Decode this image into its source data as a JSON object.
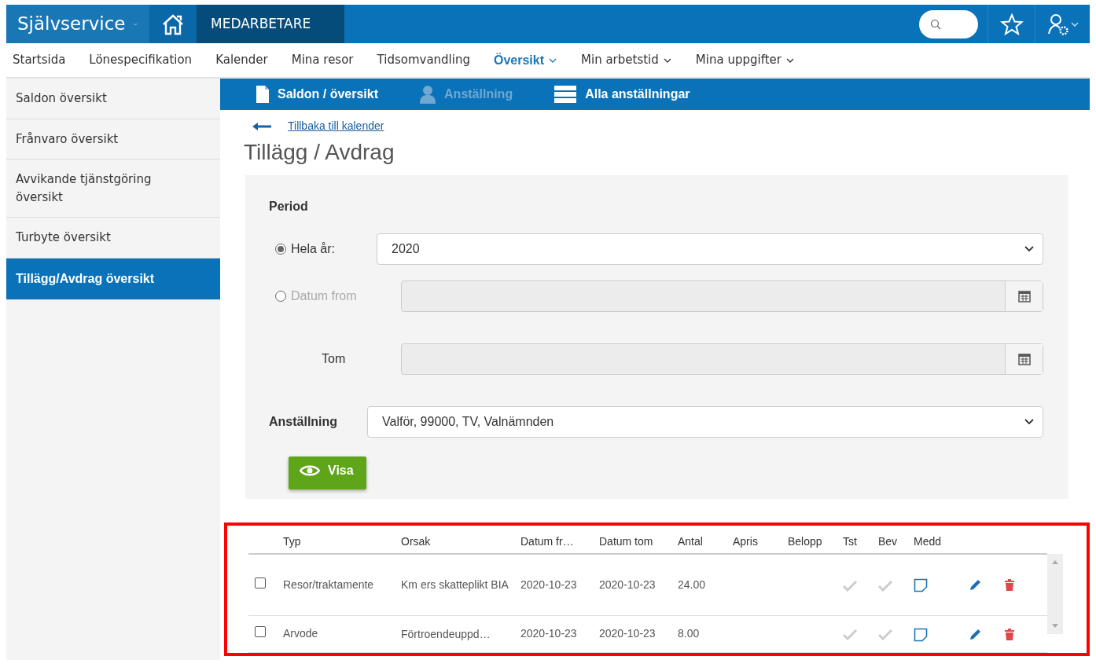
{
  "header": {
    "app_title": "Självservice",
    "module": "MEDARBETARE"
  },
  "nav": [
    {
      "label": "Startsida",
      "selected": false,
      "dropdown": false
    },
    {
      "label": "Lönespecifikation",
      "selected": false,
      "dropdown": false
    },
    {
      "label": "Kalender",
      "selected": false,
      "dropdown": false
    },
    {
      "label": "Mina resor",
      "selected": false,
      "dropdown": false
    },
    {
      "label": "Tidsomvandling",
      "selected": false,
      "dropdown": false
    },
    {
      "label": "Översikt",
      "selected": true,
      "dropdown": true
    },
    {
      "label": "Min arbetstid",
      "selected": false,
      "dropdown": true
    },
    {
      "label": "Mina uppgifter",
      "selected": false,
      "dropdown": true
    }
  ],
  "sidebar": {
    "items": [
      {
        "label": "Saldon översikt",
        "selected": false
      },
      {
        "label": "Frånvaro översikt",
        "selected": false
      },
      {
        "label": "Avvikande tjänstgöring översikt",
        "selected": false
      },
      {
        "label": "Turbyte översikt",
        "selected": false
      },
      {
        "label": "Tillägg/Avdrag översikt",
        "selected": true
      }
    ]
  },
  "subnav": [
    {
      "label": "Saldon / översikt",
      "kind": "document",
      "disabled": false
    },
    {
      "label": "Anställning",
      "kind": "person",
      "disabled": true
    },
    {
      "label": "Alla anställningar",
      "kind": "list",
      "disabled": false
    }
  ],
  "back_link": "Tillbaka till kalender",
  "page_title": "Tillägg / Avdrag",
  "form": {
    "period_label": "Period",
    "options": [
      {
        "label": "Hela år:",
        "selected": true,
        "kind": "select",
        "value": "2020"
      },
      {
        "label": "Datum from",
        "selected": false,
        "kind": "date"
      }
    ],
    "tom_label": "Tom",
    "employment_label": "Anställning",
    "employment_value": "Valför, 99000, TV, Valnämnden",
    "button": "Visa"
  },
  "table": {
    "columns": [
      "Typ",
      "Orsak",
      "Datum fr…",
      "Datum tom",
      "Antal",
      "Apris",
      "Belopp",
      "Tst",
      "Bev",
      "Medd"
    ],
    "rows": [
      {
        "checked": false,
        "cells": [
          "Resor/traktamente",
          "Km ers skatteplikt BIA",
          "2020-10-23",
          "2020-10-23",
          "24.00"
        ]
      },
      {
        "checked": false,
        "cells": [
          "Arvode",
          "Förtroendeuppd…",
          "2020-10-23",
          "2020-10-23",
          "8.00"
        ]
      }
    ]
  }
}
